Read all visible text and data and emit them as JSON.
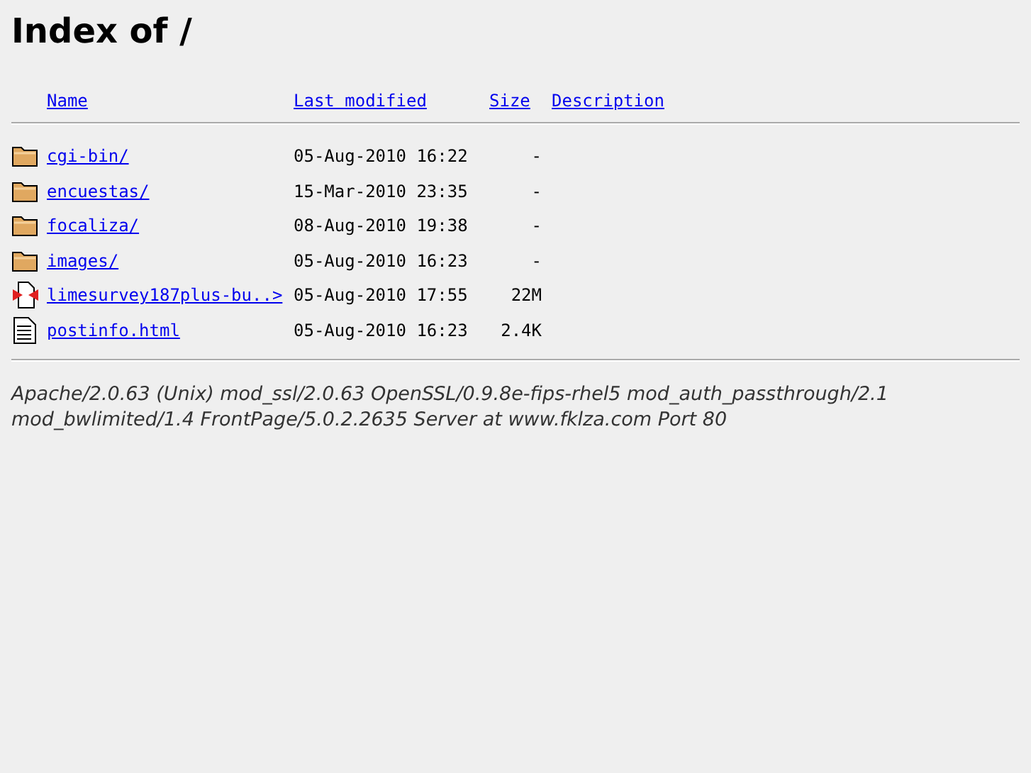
{
  "title": "Index of /",
  "columns": [
    "Name",
    "Last modified",
    "Size",
    "Description"
  ],
  "rows": [
    {
      "kind": "folder",
      "name": "cgi-bin/",
      "modified": "05-Aug-2010 16:22",
      "size": "-"
    },
    {
      "kind": "folder",
      "name": "encuestas/",
      "modified": "15-Mar-2010 23:35",
      "size": "-"
    },
    {
      "kind": "folder",
      "name": "focaliza/",
      "modified": "08-Aug-2010 19:38",
      "size": "-"
    },
    {
      "kind": "folder",
      "name": "images/",
      "modified": "05-Aug-2010 16:23",
      "size": "-"
    },
    {
      "kind": "archive",
      "name": "limesurvey187plus-bu..>",
      "modified": "05-Aug-2010 17:55",
      "size": "22M"
    },
    {
      "kind": "text",
      "name": "postinfo.html",
      "modified": "05-Aug-2010 16:23",
      "size": "2.4K"
    }
  ],
  "footer": "Apache/2.0.63 (Unix) mod_ssl/2.0.63 OpenSSL/0.9.8e-fips-rhel5 mod_auth_passthrough/2.1 mod_bwlimited/1.4 FrontPage/5.0.2.2635 Server at www.fklza.com Port 80"
}
